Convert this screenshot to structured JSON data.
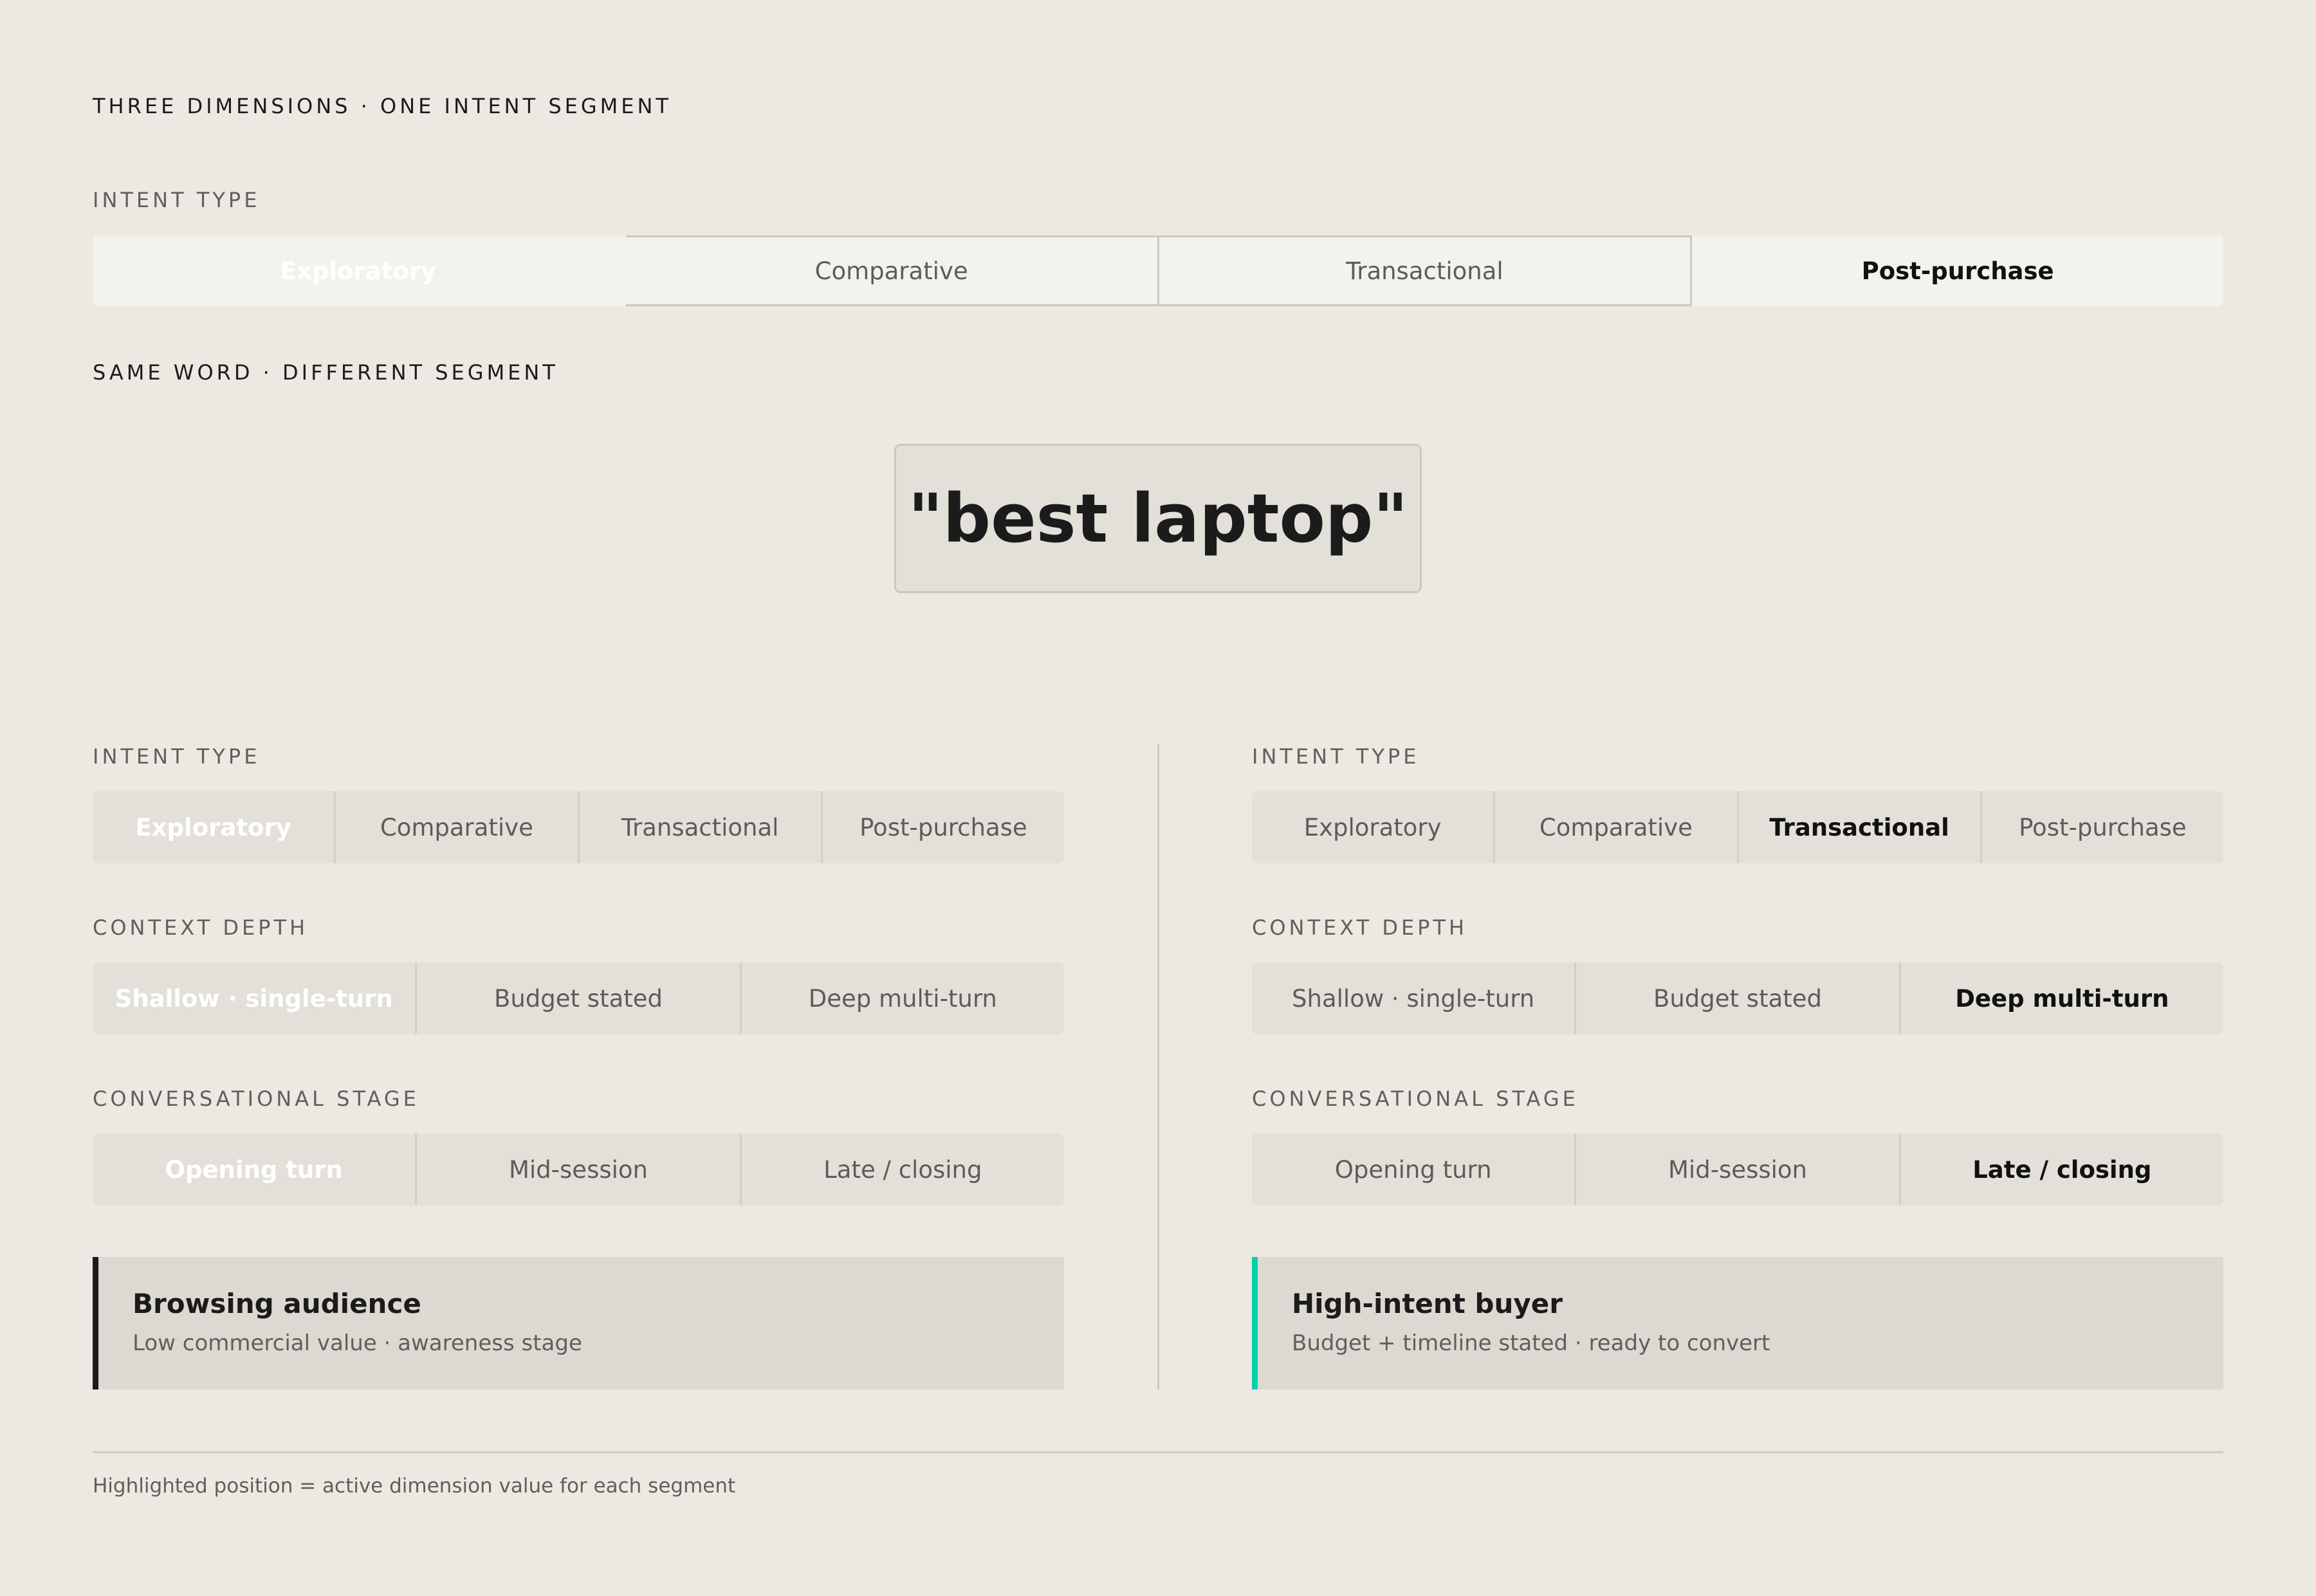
{
  "kicker": "THREE DIMENSIONS · ONE INTENT SEGMENT",
  "top": {
    "label": "INTENT TYPE",
    "options": [
      "Exploratory",
      "Comparative",
      "Transactional",
      "Post-purchase"
    ]
  },
  "same_word_label": "SAME WORD · DIFFERENT SEGMENT",
  "query": "\"best laptop\"",
  "left": {
    "intent_label": "INTENT TYPE",
    "intent_options": [
      "Exploratory",
      "Comparative",
      "Transactional",
      "Post-purchase"
    ],
    "context_label": "CONTEXT DEPTH",
    "context_options": [
      "Shallow · single-turn",
      "Budget stated",
      "Deep multi-turn"
    ],
    "stage_label": "CONVERSATIONAL STAGE",
    "stage_options": [
      "Opening turn",
      "Mid-session",
      "Late / closing"
    ],
    "result_title": "Browsing audience",
    "result_sub": "Low commercial value · awareness stage"
  },
  "right": {
    "intent_label": "INTENT TYPE",
    "intent_options": [
      "Exploratory",
      "Comparative",
      "Transactional",
      "Post-purchase"
    ],
    "context_label": "CONTEXT DEPTH",
    "context_options": [
      "Shallow · single-turn",
      "Budget stated",
      "Deep multi-turn"
    ],
    "stage_label": "CONVERSATIONAL STAGE",
    "stage_options": [
      "Opening turn",
      "Mid-session",
      "Late / closing"
    ],
    "result_title": "High-intent buyer",
    "result_sub": "Budget + timeline stated · ready to convert"
  },
  "footnote": "Highlighted position = active dimension value for each segment",
  "colors": {
    "background": "#ece9e2",
    "dark": "#1b1b1b",
    "accent": "#00d1a6"
  }
}
